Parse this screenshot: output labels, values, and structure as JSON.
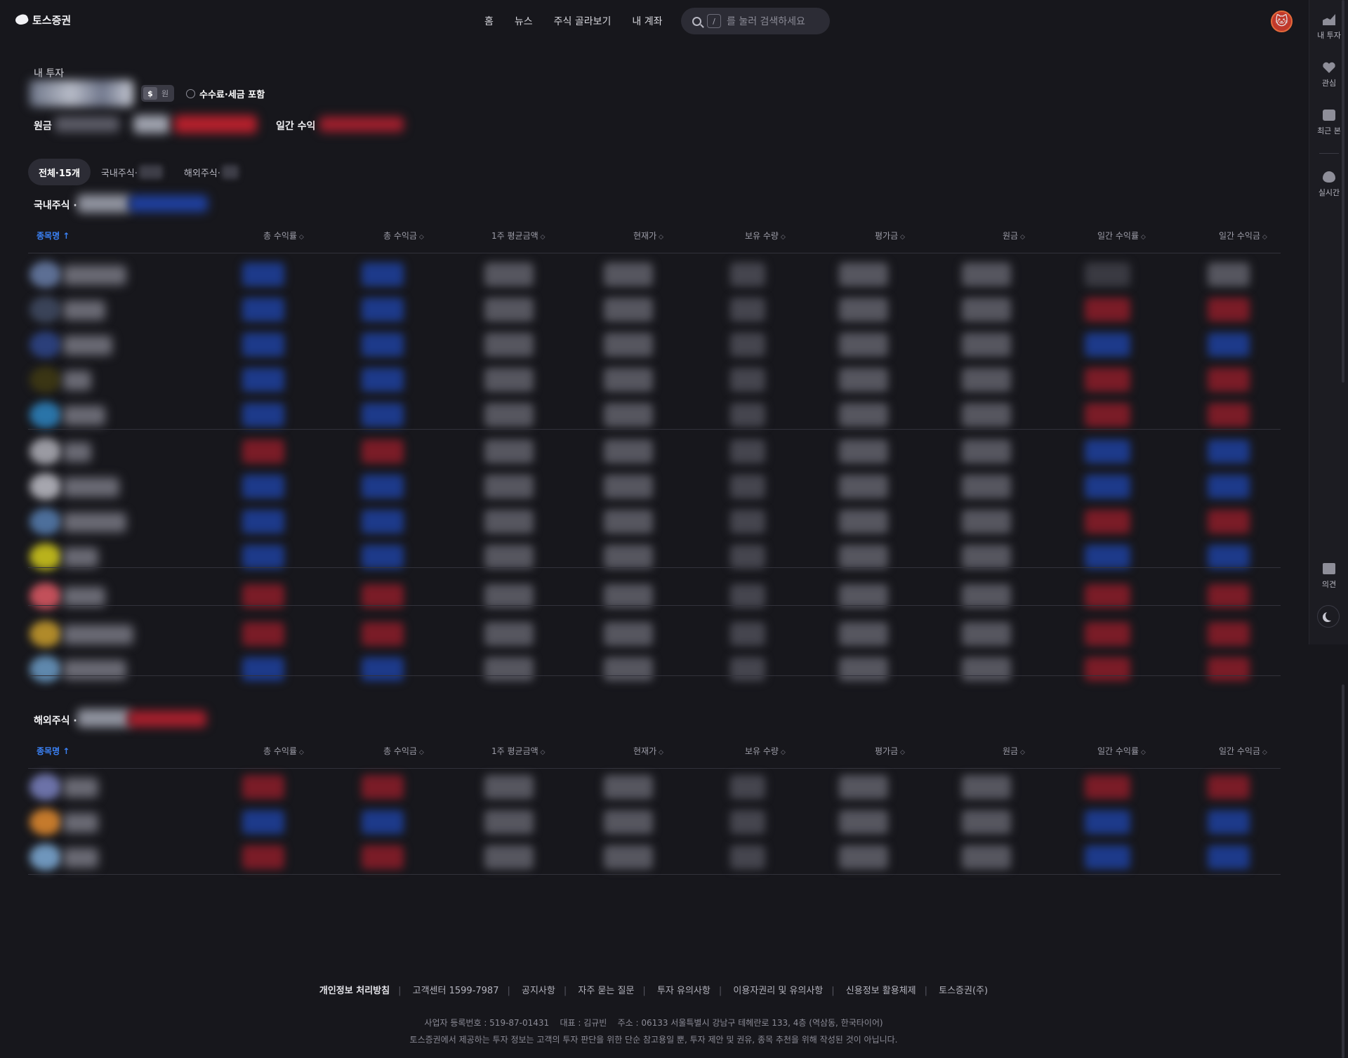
{
  "header": {
    "brand": "토스증권",
    "nav": [
      "홈",
      "뉴스",
      "주식 골라보기",
      "내 계좌"
    ],
    "search": {
      "key_hint": "/",
      "placeholder": "를 눌러 검색하세요"
    }
  },
  "rail": {
    "items": [
      {
        "label": "내 투자",
        "icon": "chart-icon"
      },
      {
        "label": "관심",
        "icon": "heart-icon"
      },
      {
        "label": "최근 본",
        "icon": "check-icon"
      },
      {
        "label": "실시간",
        "icon": "fire-icon"
      }
    ],
    "feedback": {
      "label": "의견",
      "icon": "mail-icon"
    }
  },
  "summary": {
    "title": "내 투자",
    "currency": {
      "usd": "$",
      "krw": "원"
    },
    "fee_toggle": "수수료·세금 포함",
    "principal_label": "원금",
    "daily_label": "일간 수익"
  },
  "tabs": [
    {
      "label": "전체·15개",
      "active": true
    },
    {
      "label": "국내주식·",
      "active": false
    },
    {
      "label": "해외주식·",
      "active": false
    }
  ],
  "columns": [
    "종목명",
    "총 수익률",
    "총 수익금",
    "1주 평균금액",
    "현재가",
    "보유 수량",
    "평가금",
    "원금",
    "일간 수익률",
    "일간 수익금"
  ],
  "sections": [
    {
      "title": "국내주식 ·"
    },
    {
      "title": "해외주식 ·"
    }
  ],
  "colors": {
    "up": "#b3202c",
    "down": "#1d3a8a",
    "accent": "#3b82f6",
    "background": "#17171c"
  },
  "footer": {
    "links": [
      "개인정보 처리방침",
      "고객센터 1599-7987",
      "공지사항",
      "자주 묻는 질문",
      "투자 유의사항",
      "이용자권리 및 유의사항",
      "신용정보 활용체제",
      "토스증권(주)"
    ],
    "info_line1": "사업자 등록번호 : 519-87-01431    대표 : 김규빈    주소 : 06133 서울특별시 강남구 테헤란로 133, 4층 (역삼동, 한국타이어)",
    "info_line2": "토스증권에서 제공하는 투자 정보는 고객의 투자 판단을 위한 단순 참고용일 뿐, 투자 제안 및 권유, 종목 추천을 위해 작성된 것이 아닙니다."
  }
}
